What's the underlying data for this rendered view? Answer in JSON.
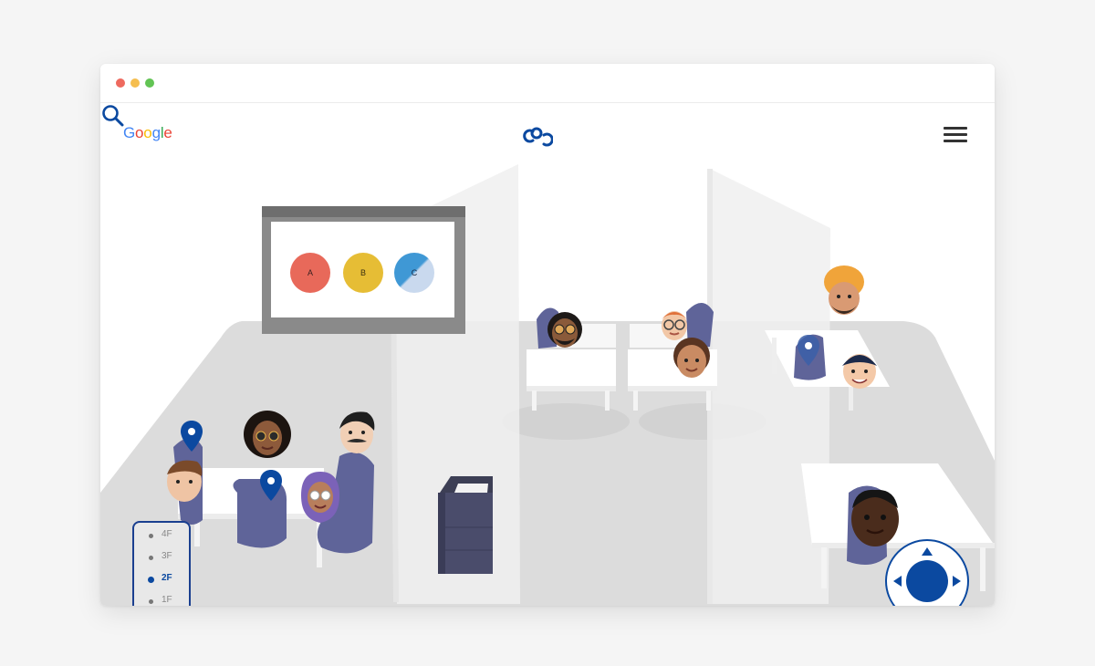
{
  "header": {
    "logo_letters": [
      {
        "ch": "G",
        "color": "#4285F4"
      },
      {
        "ch": "o",
        "color": "#EA4335"
      },
      {
        "ch": "o",
        "color": "#FBBC05"
      },
      {
        "ch": "g",
        "color": "#4285F4"
      },
      {
        "ch": "l",
        "color": "#34A853"
      },
      {
        "ch": "e",
        "color": "#EA4335"
      }
    ],
    "brand_icon": "linked-circles-icon",
    "menu_icon": "hamburger-menu-icon"
  },
  "window_controls": [
    "#ee6a5f",
    "#f5be4f",
    "#62c454"
  ],
  "presentation": {
    "options": [
      {
        "label": "A",
        "color": "#e8695a"
      },
      {
        "label": "B",
        "color": "#e6bd35"
      },
      {
        "label": "C",
        "color": "#3f98d5"
      }
    ]
  },
  "floor_selector": {
    "floors": [
      {
        "label": "4F",
        "active": false
      },
      {
        "label": "3F",
        "active": false
      },
      {
        "label": "2F",
        "active": true
      },
      {
        "label": "1F",
        "active": false
      }
    ]
  },
  "controls": {
    "joystick_icon": "joystick-icon",
    "search_icon": "search-icon"
  },
  "colors": {
    "accent": "#0b49a0",
    "chair": "#5f6499",
    "floor": "#dcdcdc"
  }
}
